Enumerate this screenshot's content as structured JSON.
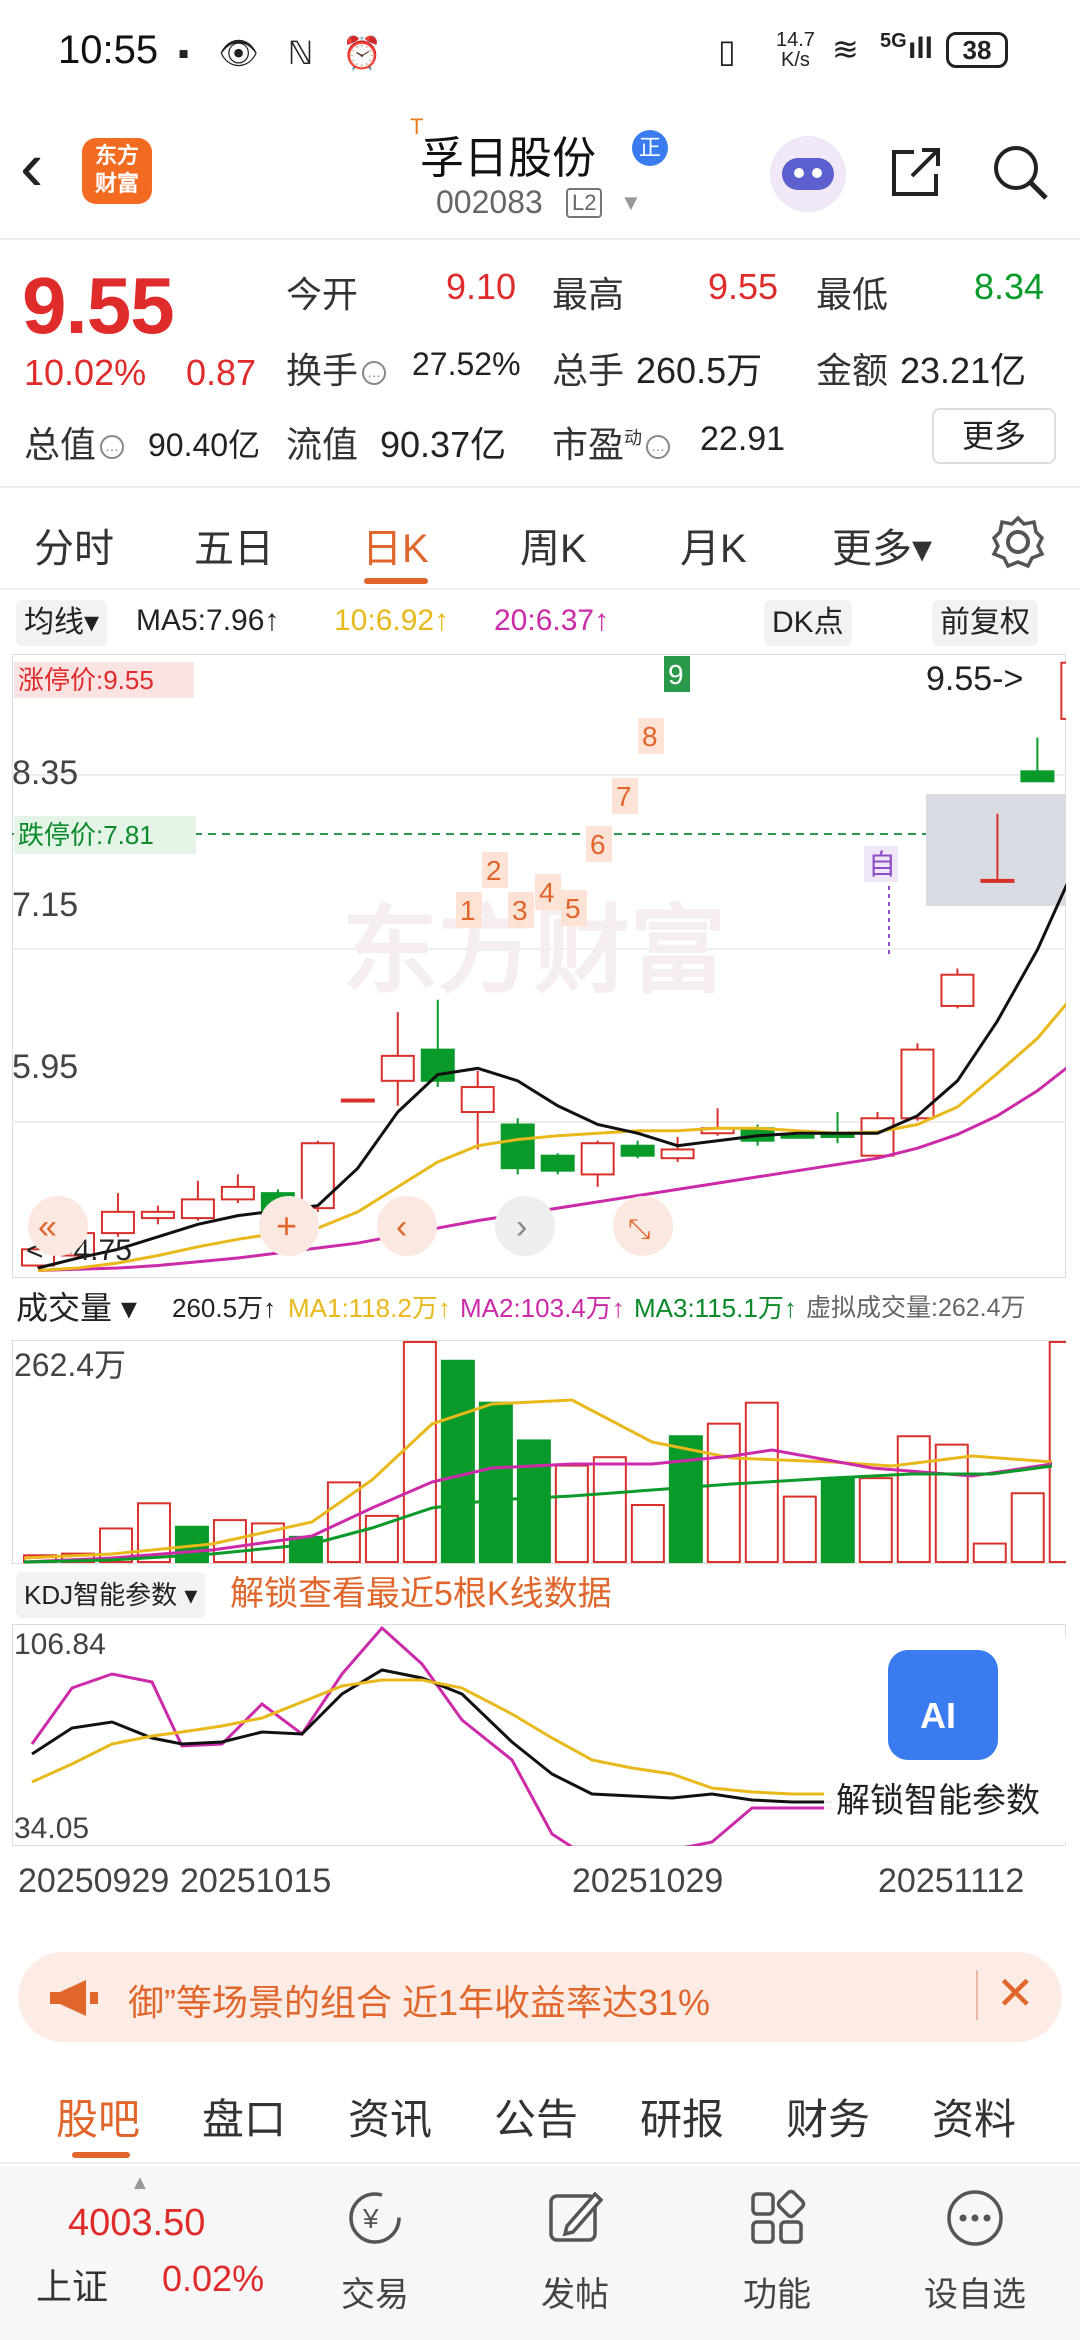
{
  "status_bar": {
    "time": "10:55",
    "net_speed": "14.7",
    "net_unit": "K/s",
    "network": "5G",
    "battery": "38"
  },
  "header": {
    "logo_line1": "东方",
    "logo_line2": "财富",
    "t_mark": "T",
    "stock_name": "孚日股份",
    "badge": "正",
    "stock_code": "002083",
    "level_badge": "L2",
    "icons": [
      "back-icon",
      "robot-avatar",
      "share-icon",
      "search-icon"
    ]
  },
  "quote": {
    "price": "9.55",
    "change_pct": "10.02%",
    "change": "0.87",
    "open_label": "今开",
    "open": "9.10",
    "high_label": "最高",
    "high": "9.55",
    "low_label": "最低",
    "low": "8.34",
    "turnover_label": "换手",
    "turnover": "27.52%",
    "volume_label": "总手",
    "volume": "260.5万",
    "amount_label": "金额",
    "amount": "23.21亿",
    "mcap_label": "总值",
    "mcap": "90.40亿",
    "float_label": "流值",
    "float_cap": "90.37亿",
    "pe_label": "市盈",
    "pe_sup": "动",
    "pe": "22.91",
    "more_btn": "更多"
  },
  "period_tabs": [
    "分时",
    "五日",
    "日K",
    "周K",
    "月K",
    "更多▾"
  ],
  "active_period": "日K",
  "indicators": {
    "ma_select": "均线▾",
    "ma5": "MA5:7.96↑",
    "ma10": "10:6.92↑",
    "ma20": "20:6.37↑",
    "dk_btn": "DK点",
    "fq_btn": "前复权"
  },
  "kline_labels": {
    "limit_up": "涨停价:9.55",
    "limit_down": "跌停价:7.81",
    "y_ticks": [
      "8.35",
      "7.15",
      "5.95",
      "4.75"
    ],
    "last_price_tag": "9.55->",
    "low_tag": "<---4.75",
    "zi_tag": "自",
    "watermark": "东方财富",
    "markers": [
      "1",
      "2",
      "3",
      "4",
      "5",
      "6",
      "7",
      "8",
      "9"
    ]
  },
  "volume": {
    "select": "成交量 ▾",
    "val": "260.5万↑",
    "ma1": "MA1:118.2万↑",
    "ma2": "MA2:103.4万↑",
    "ma3": "MA3:115.1万↑",
    "virtual": "虚拟成交量:262.4万",
    "y_max": "262.4万"
  },
  "kdj": {
    "select": "KDJ智能参数 ▾",
    "unlock_text": "解锁查看最近5根K线数据",
    "y_max": "106.84",
    "y_min": "34.05",
    "ai_label": "AI",
    "ai_unlock": "解锁智能参数"
  },
  "x_dates": [
    "20250929",
    "20251015",
    "20251029",
    "20251112"
  ],
  "banner": {
    "text": "御”等场景的组合 近1年收益率达31%"
  },
  "content_tabs": [
    "股吧",
    "盘口",
    "资讯",
    "公告",
    "研报",
    "财务",
    "资料"
  ],
  "active_content_tab": "股吧",
  "index_quote": {
    "value": "4003.50",
    "name": "上证",
    "pct": "0.02%"
  },
  "bottom_nav": [
    "交易",
    "发帖",
    "功能",
    "设自选"
  ],
  "chart_data": {
    "type": "candlestick",
    "title": "",
    "price_ylim": [
      4.75,
      9.55
    ],
    "dates": [
      "20250929",
      "20251015",
      "20251029",
      "20251112"
    ],
    "candles": [
      {
        "o": 4.72,
        "c": 4.85,
        "h": 4.9,
        "l": 4.7
      },
      {
        "o": 4.8,
        "c": 4.98,
        "h": 5.05,
        "l": 4.78
      },
      {
        "o": 4.98,
        "c": 5.15,
        "h": 5.3,
        "l": 4.95
      },
      {
        "o": 5.1,
        "c": 5.15,
        "h": 5.2,
        "l": 5.05
      },
      {
        "o": 5.1,
        "c": 5.25,
        "h": 5.4,
        "l": 5.08
      },
      {
        "o": 5.25,
        "c": 5.35,
        "h": 5.45,
        "l": 5.22
      },
      {
        "o": 5.3,
        "c": 5.12,
        "h": 5.33,
        "l": 5.1
      },
      {
        "o": 5.18,
        "c": 5.7,
        "h": 5.72,
        "l": 5.15
      },
      {
        "o": 6.05,
        "c": 6.05,
        "h": 6.05,
        "l": 6.05
      },
      {
        "o": 6.2,
        "c": 6.4,
        "h": 6.75,
        "l": 6.0
      },
      {
        "o": 6.45,
        "c": 6.2,
        "h": 6.85,
        "l": 6.15
      },
      {
        "o": 5.95,
        "c": 6.15,
        "h": 6.28,
        "l": 5.65
      },
      {
        "o": 5.85,
        "c": 5.5,
        "h": 5.9,
        "l": 5.45
      },
      {
        "o": 5.6,
        "c": 5.48,
        "h": 5.62,
        "l": 5.45
      },
      {
        "o": 5.45,
        "c": 5.7,
        "h": 5.72,
        "l": 5.35
      },
      {
        "o": 5.68,
        "c": 5.6,
        "h": 5.72,
        "l": 5.58
      },
      {
        "o": 5.58,
        "c": 5.65,
        "h": 5.75,
        "l": 5.55
      },
      {
        "o": 5.78,
        "c": 5.82,
        "h": 5.98,
        "l": 5.76
      },
      {
        "o": 5.82,
        "c": 5.72,
        "h": 5.85,
        "l": 5.68
      },
      {
        "o": 5.76,
        "c": 5.75,
        "h": 5.76,
        "l": 5.74
      },
      {
        "o": 5.78,
        "c": 5.75,
        "h": 5.95,
        "l": 5.7
      },
      {
        "o": 5.6,
        "c": 5.9,
        "h": 5.95,
        "l": 5.58
      },
      {
        "o": 5.9,
        "c": 6.45,
        "h": 6.5,
        "l": 5.88
      },
      {
        "o": 6.8,
        "c": 7.05,
        "h": 7.1,
        "l": 6.78
      },
      {
        "o": 7.81,
        "c": 7.81,
        "h": 8.34,
        "l": 7.81
      },
      {
        "o": 8.68,
        "c": 8.6,
        "h": 8.95,
        "l": 8.6
      },
      {
        "o": 9.1,
        "c": 9.55,
        "h": 9.55,
        "l": 8.34
      }
    ],
    "ma5": [
      4.7,
      4.78,
      4.85,
      4.95,
      5.05,
      5.12,
      5.16,
      5.2,
      5.5,
      5.95,
      6.25,
      6.3,
      6.2,
      6.0,
      5.85,
      5.78,
      5.68,
      5.72,
      5.76,
      5.78,
      5.78,
      5.78,
      5.92,
      6.2,
      6.68,
      7.25,
      7.96
    ],
    "ma10": [
      4.68,
      4.7,
      4.74,
      4.8,
      4.87,
      4.93,
      4.98,
      5.02,
      5.15,
      5.35,
      5.55,
      5.68,
      5.73,
      5.76,
      5.78,
      5.8,
      5.8,
      5.82,
      5.82,
      5.8,
      5.78,
      5.79,
      5.85,
      5.99,
      6.26,
      6.54,
      6.92
    ],
    "ma20": [
      4.68,
      4.69,
      4.7,
      4.72,
      4.75,
      4.78,
      4.82,
      4.86,
      4.9,
      4.96,
      5.02,
      5.08,
      5.13,
      5.18,
      5.23,
      5.28,
      5.33,
      5.38,
      5.43,
      5.48,
      5.53,
      5.58,
      5.66,
      5.77,
      5.92,
      6.12,
      6.37
    ],
    "volume_ylim": [
      0,
      262.4
    ],
    "volume_up": [
      true,
      true,
      true,
      true,
      false,
      true,
      true,
      false,
      true,
      true,
      true,
      false,
      false,
      false,
      false,
      true,
      true,
      false,
      true,
      true,
      true,
      true,
      true,
      true,
      true,
      true,
      true
    ],
    "volume_values": [
      8,
      10,
      40,
      70,
      42,
      50,
      46,
      30,
      95,
      55,
      262.4,
      240,
      190,
      145,
      115,
      125,
      68,
      150,
      165,
      190,
      78,
      100,
      100,
      150,
      140,
      22,
      82,
      262.4
    ],
    "kdj_ylim": [
      34.05,
      106.84
    ]
  }
}
